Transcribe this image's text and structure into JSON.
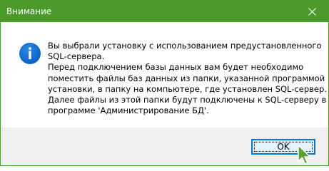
{
  "window": {
    "title": "Внимание"
  },
  "colors": {
    "titlebar": "#4c9a2c",
    "info_icon": "#0a6ad2",
    "button_border": "#0078d7",
    "cursor": "#5aa02c"
  },
  "icons": {
    "close": "close-icon",
    "info": "info-icon",
    "cursor": "arrow-cursor-icon"
  },
  "message": {
    "lines": [
      "Вы выбрали установку с использованием предустановленного",
      "SQL-сервера.",
      "Перед подключением базы данных вам будет необходимо",
      "поместить файлы баз данных из папки, указанной программой",
      "установки, в папку на компьютере, где установлен SQL-сервер.",
      "Далее файлы из этой папки будут подключены к SQL-серверу в",
      "программе 'Администрирование БД'."
    ]
  },
  "buttons": {
    "ok": "OK"
  }
}
